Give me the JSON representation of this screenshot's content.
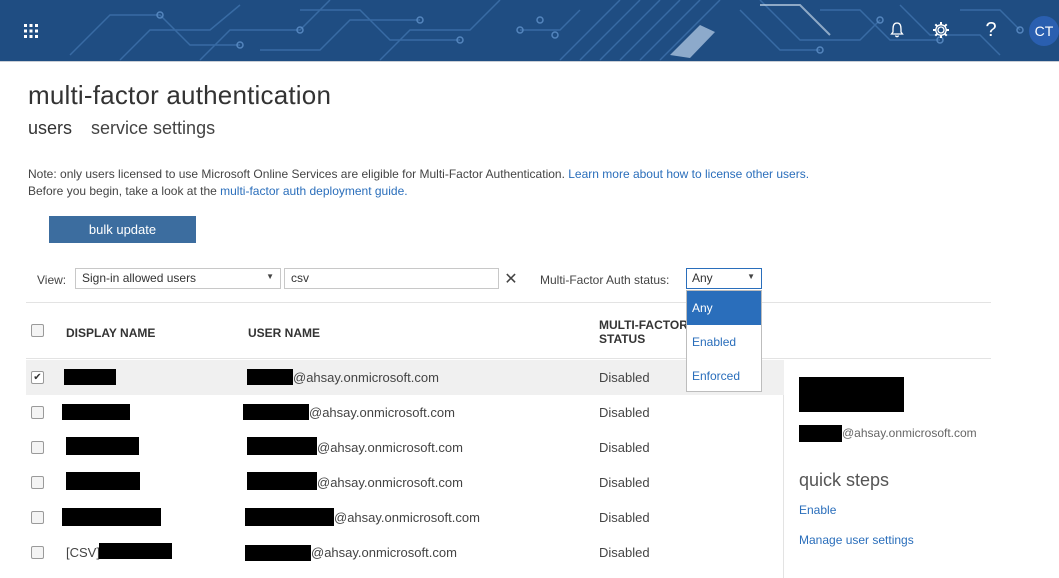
{
  "topbar": {
    "avatar_initials": "CT",
    "icons": [
      "waffle-icon",
      "bell-icon",
      "gear-icon",
      "help-icon"
    ],
    "bg_color": "#1f4d82"
  },
  "page": {
    "title": "multi-factor authentication",
    "tabs": [
      {
        "label": "users",
        "active": true
      },
      {
        "label": "service settings",
        "active": false
      }
    ]
  },
  "note": {
    "line1": "Note: only users licensed to use Microsoft Online Services are eligible for Multi-Factor Authentication. ",
    "line1_link": "Learn more about how to license other users.",
    "line2": "Before you begin, take a look at the ",
    "line2_link": "multi-factor auth deployment guide."
  },
  "bulk_update_label": "bulk update",
  "filters": {
    "view_label": "View:",
    "view_value": "Sign-in allowed users",
    "search_value": "csv",
    "mfa_label": "Multi-Factor Auth status:",
    "mfa_value": "Any",
    "mfa_options": [
      {
        "label": "Any",
        "selected": true
      },
      {
        "label": "Enabled",
        "selected": false
      },
      {
        "label": "Enforced",
        "selected": false
      }
    ]
  },
  "table": {
    "headers": {
      "display_name": "DISPLAY NAME",
      "user_name": "USER NAME",
      "mfa_status_line1": "MULTI-FACTOR",
      "mfa_status_line2": "STATUS"
    },
    "rows": [
      {
        "display_prefix": "",
        "user_suffix": "@ahsay.onmicrosoft.com",
        "status": "Disabled",
        "checked": true
      },
      {
        "display_prefix": "",
        "user_suffix": "@ahsay.onmicrosoft.com",
        "status": "Disabled",
        "checked": false
      },
      {
        "display_prefix": "",
        "user_suffix": "@ahsay.onmicrosoft.com",
        "status": "Disabled",
        "checked": false
      },
      {
        "display_prefix": "",
        "user_suffix": "@ahsay.onmicrosoft.com",
        "status": "Disabled",
        "checked": false
      },
      {
        "display_prefix": "",
        "user_suffix": "@ahsay.onmicrosoft.com",
        "status": "Disabled",
        "checked": false
      },
      {
        "display_prefix": "[CSV]",
        "user_suffix": "@ahsay.onmicrosoft.com",
        "status": "Disabled",
        "checked": false
      }
    ]
  },
  "detail_panel": {
    "user_suffix": "@ahsay.onmicrosoft.com",
    "quick_steps_title": "quick steps",
    "links": [
      "Enable",
      "Manage user settings"
    ]
  }
}
